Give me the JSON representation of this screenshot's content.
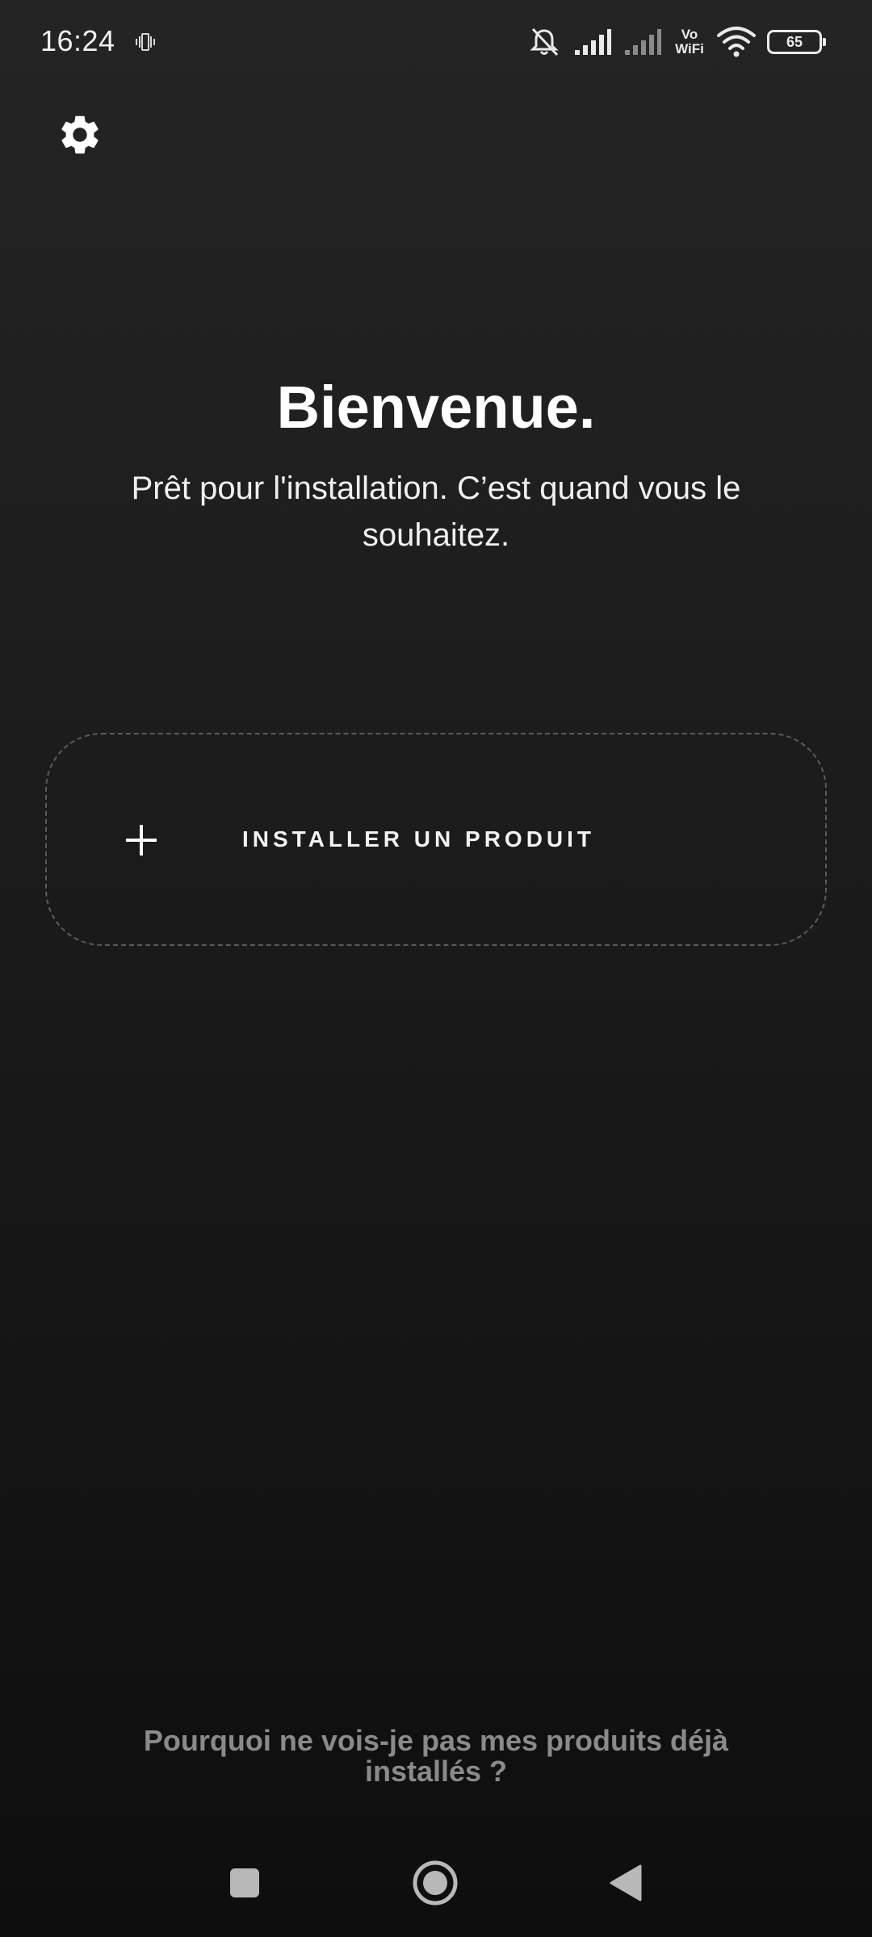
{
  "status_bar": {
    "time": "16:24",
    "vowifi_top": "Vo",
    "vowifi_bottom": "WiFi",
    "battery": "65"
  },
  "welcome": {
    "title": "Bienvenue.",
    "subtitle": "Prêt pour l'installation. C’est quand vous le souhaitez."
  },
  "install": {
    "label": "INSTALLER UN PRODUIT"
  },
  "help_link": "Pourquoi ne vois-je pas mes produits déjà installés ?",
  "colors": {
    "background_top": "#242424",
    "background_bottom": "#0e0e0e",
    "text_primary": "#ffffff",
    "text_muted": "#8a8a8a",
    "dashed_border": "#5a5a5a"
  },
  "icons": {
    "settings": "gear-icon",
    "install": "plus-icon",
    "nav_recent": "square-icon",
    "nav_home": "circle-icon",
    "nav_back": "triangle-back-icon"
  }
}
